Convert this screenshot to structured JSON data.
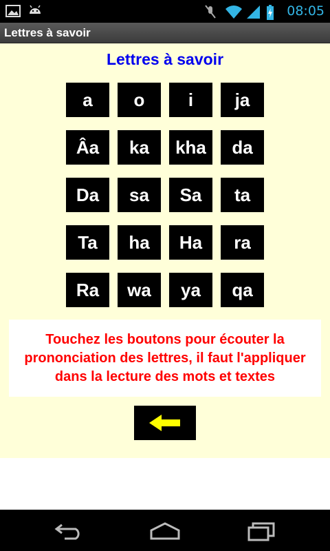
{
  "status_bar": {
    "time": "08:05",
    "icons": [
      "image-icon",
      "android-icon",
      "mute-icon",
      "wifi-icon",
      "signal-icon",
      "battery-charging-icon"
    ]
  },
  "app_bar": {
    "title": "Lettres à savoir"
  },
  "main": {
    "heading": "Lettres à savoir",
    "letters": [
      [
        "a",
        "o",
        "i",
        "ja"
      ],
      [
        "Âa",
        "ka",
        "kha",
        "da"
      ],
      [
        "Da",
        "sa",
        "Sa",
        "ta"
      ],
      [
        "Ta",
        "ha",
        "Ha",
        "ra"
      ],
      [
        "Ra",
        "wa",
        "ya",
        "qa"
      ]
    ],
    "instruction": "Touchez les boutons pour écouter la prononciation des lettres, il faut l'appliquer dans la lecture des mots et textes",
    "back_icon": "arrow-left-icon"
  },
  "nav_bar": {
    "icons": [
      "back-icon",
      "home-icon",
      "recent-apps-icon"
    ]
  },
  "colors": {
    "background": "#ffffd9",
    "heading": "#0000ee",
    "instruction": "#ff0000",
    "arrow": "#ffff00",
    "status_accent": "#33b5e5"
  }
}
